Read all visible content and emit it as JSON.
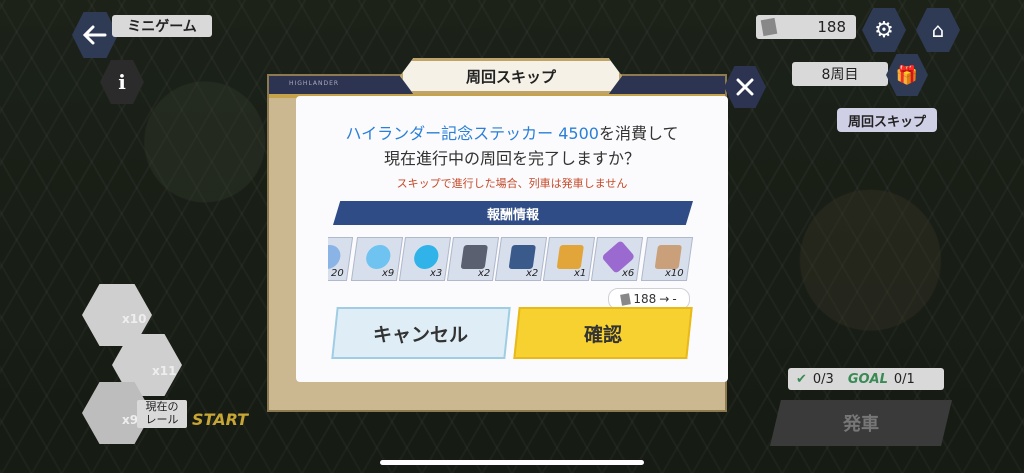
{
  "header": {
    "title": "ミニゲーム",
    "currency": "188"
  },
  "status": {
    "lap": "8周目",
    "skip_button": "周回スキップ"
  },
  "rails": {
    "items": [
      {
        "count": "x10"
      },
      {
        "count": "x11"
      },
      {
        "count": "x9"
      }
    ],
    "current_label": "現在の\nレール",
    "start_label": "START"
  },
  "goal": {
    "left": "0/3",
    "goal_word": "GOAL",
    "right": "0/1"
  },
  "depart_button": "発車",
  "modal": {
    "title": "周回スキップ",
    "brand": "HIGHLANDER",
    "message_highlight": "ハイランダー記念ステッカー 4500",
    "message_rest": "を消費して",
    "message_line2": "現在進行中の周回を完了しますか？",
    "warning": "スキップで進行した場合、列車は発車しません",
    "reward_header": "報酬情報",
    "rewards": [
      {
        "count": "20",
        "color": "#8ab4e6"
      },
      {
        "count": "x9",
        "color": "#6fc3f0"
      },
      {
        "count": "x3",
        "color": "#2fb3e8"
      },
      {
        "count": "x2",
        "color": "#5a6070"
      },
      {
        "count": "x2",
        "color": "#3b5a8c"
      },
      {
        "count": "x1",
        "color": "#e2a53a"
      },
      {
        "count": "x6",
        "color": "#9b6ad1"
      },
      {
        "count": "x10",
        "color": "#c9a07a"
      }
    ],
    "cost_from": "188",
    "cost_to": "-",
    "cancel_label": "キャンセル",
    "confirm_label": "確認"
  }
}
